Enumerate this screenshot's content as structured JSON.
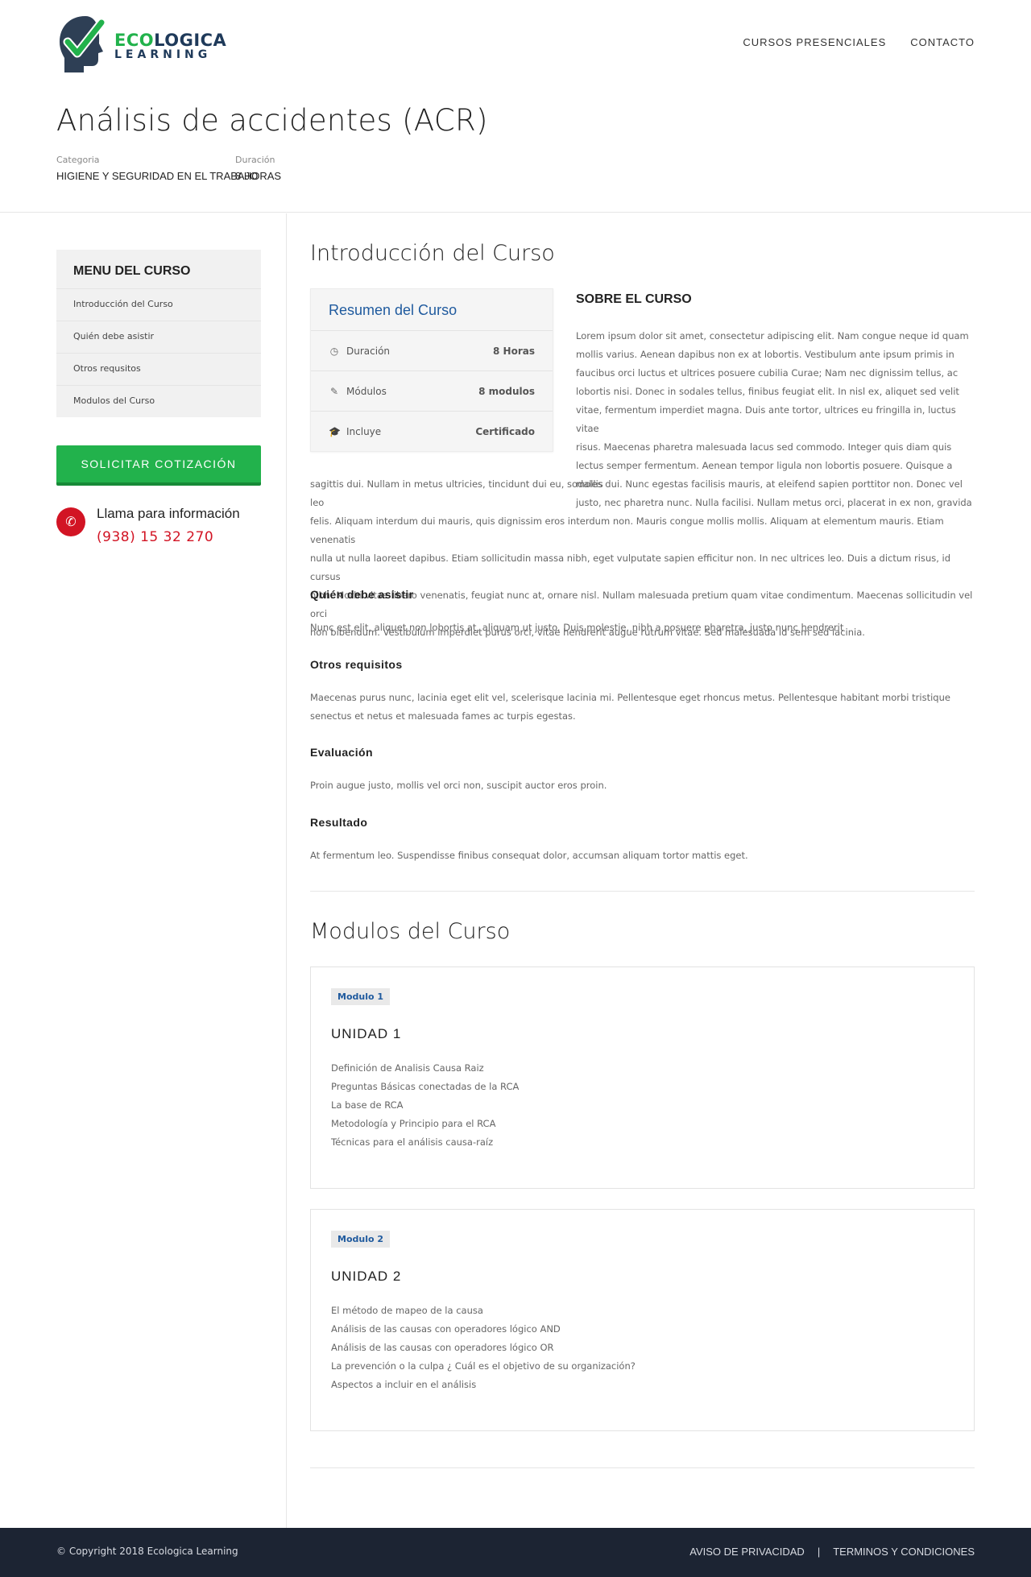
{
  "brand": {
    "name_eco": "ECO",
    "name_rest": "LOGICA",
    "tagline": "LEARNING",
    "colors": {
      "green": "#22b24c",
      "navy": "#1f3a5a",
      "red": "#d21424",
      "link_blue": "#1f5a9e"
    }
  },
  "nav": {
    "items": [
      "CURSOS PRESENCIALES",
      "CONTACTO"
    ]
  },
  "course": {
    "title": "Análisis de accidentes (ACR)",
    "category_label": "Categoria",
    "category_value": "HIGIENE Y SEGURIDAD EN EL TRABAJO",
    "duration_label": "Duración",
    "duration_value": "8 HORAS"
  },
  "sidebar": {
    "menu_title": "MENU DEL CURSO",
    "items": [
      "Introducción del Curso",
      "Quién debe asistir",
      "Otros requsitos",
      "Modulos del Curso"
    ],
    "quote_button": "SOLICITAR COTIZACIÓN",
    "call_label": "Llama para información",
    "call_phone": "(938) 15 32 270"
  },
  "intro": {
    "heading": "Introducción del Curso",
    "summary": {
      "title": "Resumen del Curso",
      "rows": [
        {
          "icon": "clock-icon",
          "label": "Duración",
          "value": "8 Horas"
        },
        {
          "icon": "edit-icon",
          "label": "Módulos",
          "value": "8 modulos"
        },
        {
          "icon": "graduation-cap-icon",
          "label": "Incluye",
          "value": "Certificado"
        }
      ]
    },
    "about_title": "SOBRE EL CURSO",
    "about_lines_side": [
      "Lorem ipsum dolor sit amet, consectetur adipiscing elit. Nam congue neque id quam",
      "mollis varius. Aenean dapibus non ex at lobortis. Vestibulum ante ipsum primis in",
      "faucibus orci luctus et ultrices posuere cubilia Curae; Nam nec dignissim tellus, ac",
      "lobortis nisi. Donec in sodales tellus, finibus feugiat elit. In nisl ex, aliquet sed velit",
      "vitae, fermentum imperdiet magna. Duis ante tortor, ultrices eu fringilla in, luctus vitae",
      "risus. Maecenas pharetra malesuada lacus sed commodo. Integer quis diam quis",
      "lectus semper fermentum. Aenean tempor ligula non lobortis posuere. Quisque a mollis",
      "justo, nec pharetra nunc. Nulla facilisi. Nullam metus orci, placerat in ex non, gravida"
    ],
    "about_lines_full": [
      "sagittis dui. Nullam in metus ultricies, tincidunt dui eu, sodales dui. Nunc egestas facilisis mauris, at eleifend sapien porttitor non. Donec vel leo",
      "felis. Aliquam interdum dui mauris, quis dignissim eros interdum non. Mauris congue mollis mollis. Aliquam at elementum mauris. Etiam venenatis",
      "nulla ut nulla laoreet dapibus. Etiam sollicitudin massa nibh, eget vulputate sapien efficitur non. In nec ultrices leo. Duis a dictum risus, id cursus",
      "nibh. Morbi vitae libero venenatis, feugiat nunc at, ornare nisl. Nullam malesuada pretium quam vitae condimentum. Maecenas sollicitudin vel orci",
      "non bibendum. Vestibulum imperdiet purus orci, vitae hendrerit augue rutrum vitae. Sed malesuada id sem sed lacinia."
    ]
  },
  "sections": [
    {
      "title": "Quién debe asistir",
      "lines": [
        "Nunc est elit, aliquet non lobortis at, aliquam ut justo. Duis molestie, nibh a posuere pharetra, justo nunc hendrerit"
      ]
    },
    {
      "title": "Otros requisitos",
      "lines": [
        "Maecenas purus nunc, lacinia eget elit vel, scelerisque lacinia mi. Pellentesque eget rhoncus metus. Pellentesque habitant morbi tristique",
        "senectus et netus et malesuada fames ac turpis egestas."
      ]
    },
    {
      "title": "Evaluación",
      "lines": [
        "Proin augue justo, mollis vel orci non, suscipit auctor eros proin."
      ]
    },
    {
      "title": "Resultado",
      "lines": [
        "At fermentum leo. Suspendisse finibus consequat dolor, accumsan aliquam tortor mattis eget."
      ]
    }
  ],
  "modules": {
    "heading": "Modulos del Curso",
    "items": [
      {
        "badge": "Modulo 1",
        "unit": "UNIDAD 1",
        "topics": [
          "Definición de Analisis Causa Raiz",
          "Preguntas Básicas conectadas de la RCA",
          "La base de RCA",
          "Metodología y Principio para el RCA",
          "Técnicas para el análisis causa-raíz"
        ]
      },
      {
        "badge": "Modulo 2",
        "unit": "UNIDAD 2",
        "topics": [
          "El método de mapeo de la causa",
          "Análisis de las causas con operadores lógico AND",
          "Análisis de las causas con operadores lógico OR",
          "La prevención o la culpa ¿ Cuál es el objetivo de su organización?",
          "Aspectos a incluir en el análisis"
        ]
      }
    ]
  },
  "footer": {
    "copyright": "© Copyright 2018 Ecologica Learning",
    "link_privacy": "AVISO DE PRIVACIDAD",
    "separator": "|",
    "link_terms": "TERMINOS Y CONDICIONES"
  }
}
